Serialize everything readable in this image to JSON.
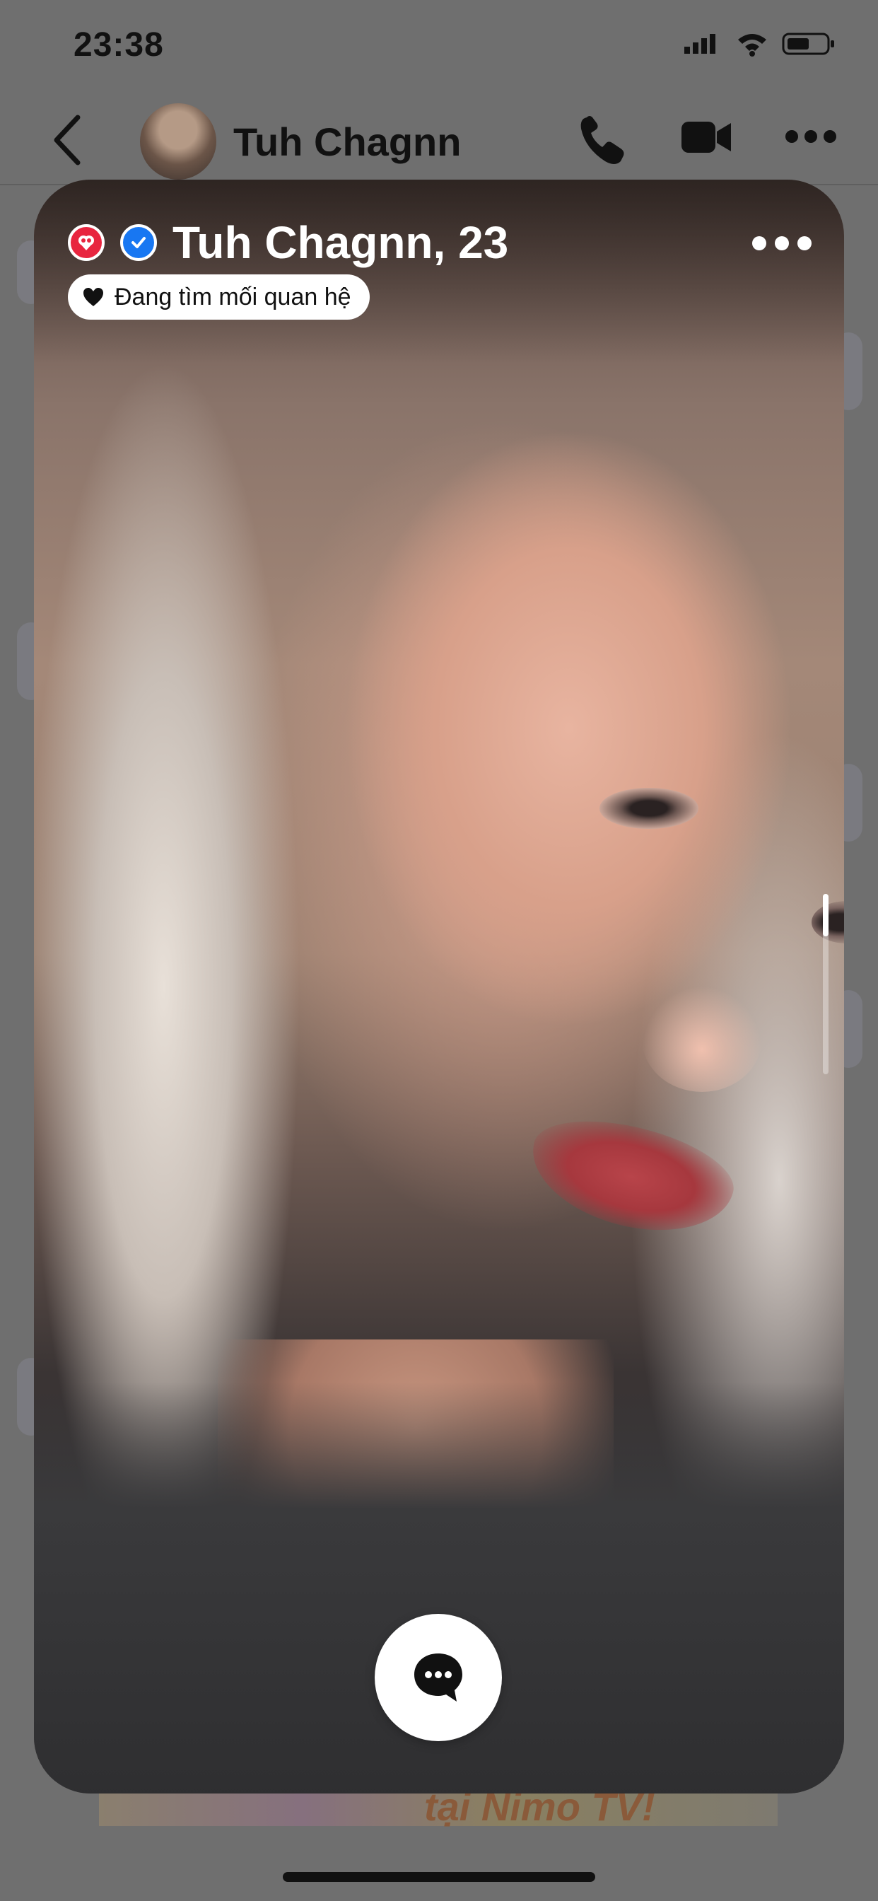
{
  "status_bar": {
    "time": "23:38"
  },
  "chat_header": {
    "contact_name": "Tuh Chagnn"
  },
  "profile_card": {
    "name_age": "Tuh Chagnn, 23",
    "intent_label": "Đang tìm mối quan hệ",
    "photo_scroll_position": 0.0
  },
  "background": {
    "banner_text": "tại Nimo TV!"
  },
  "colors": {
    "dating_badge": "#e8253f",
    "verified_badge": "#1877f2",
    "overlay": "#6f6f6f"
  },
  "icons": {
    "back": "chevron-left-icon",
    "call": "phone-icon",
    "video": "video-camera-icon",
    "more": "more-horizontal-icon",
    "dating": "dating-heart-icon",
    "verified": "verified-check-icon",
    "intent": "heart-icon",
    "chat": "chat-bubble-icon"
  }
}
